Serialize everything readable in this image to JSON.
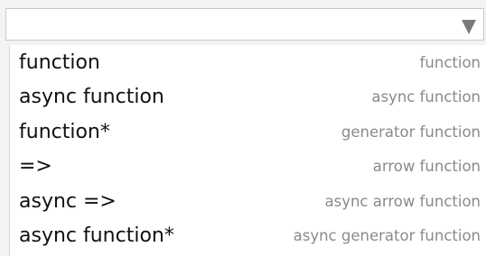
{
  "select": {
    "value": "",
    "arrow_icon": "triangle-down-icon"
  },
  "options": [
    {
      "label": "function",
      "kind": "function"
    },
    {
      "label": "async function",
      "kind": "async function"
    },
    {
      "label": "function*",
      "kind": "generator function"
    },
    {
      "label": "=>",
      "kind": "arrow function"
    },
    {
      "label": "async =>",
      "kind": "async arrow function"
    },
    {
      "label": "async function*",
      "kind": "async generator function"
    }
  ],
  "colors": {
    "text": "#111111",
    "secondary_text": "#8a8a8a",
    "border": "#c8c8c8"
  }
}
